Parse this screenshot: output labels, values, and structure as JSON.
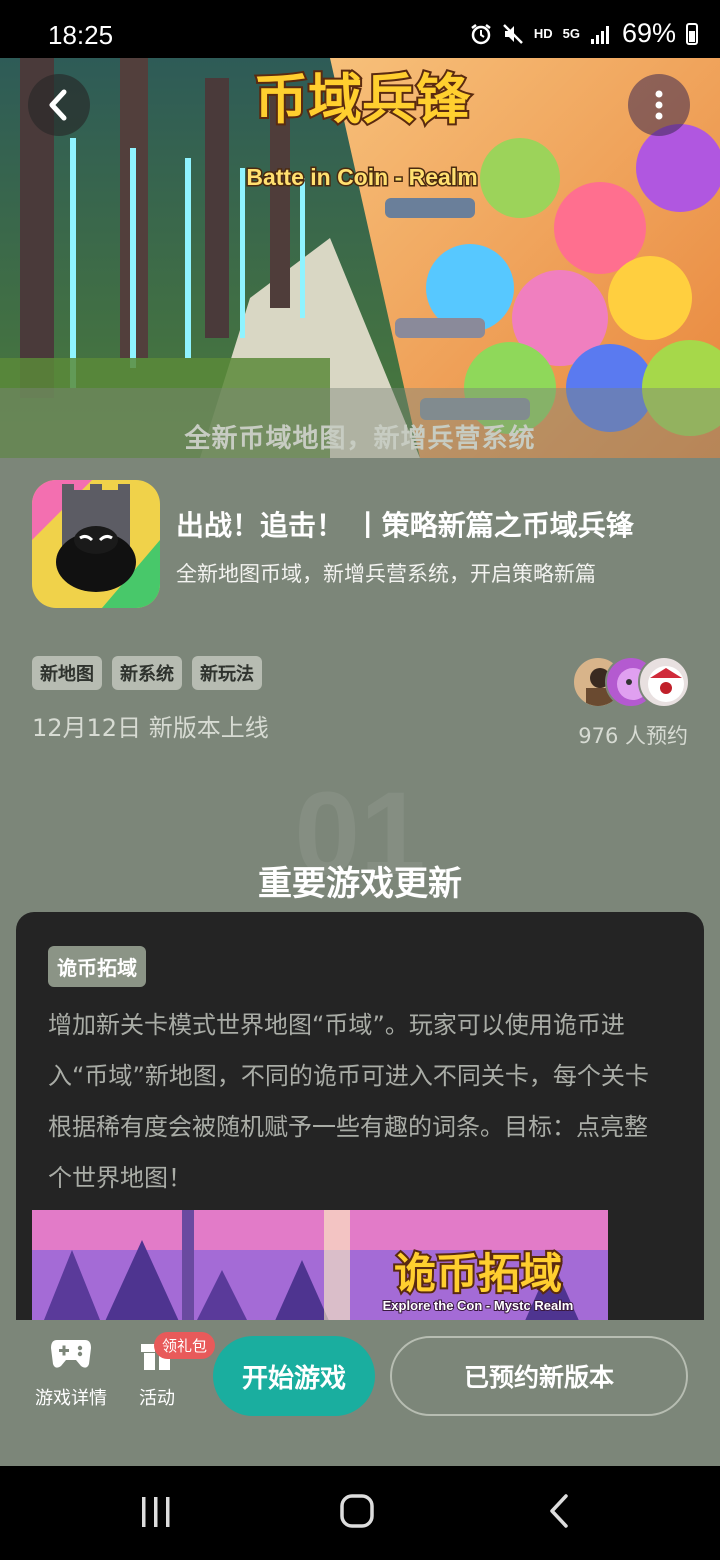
{
  "status_bar": {
    "time": "18:25",
    "icons": [
      "alarm-icon",
      "mute-icon",
      "hd-icon",
      "5g-icon",
      "signal-icon"
    ],
    "hd": "HD",
    "net": "5G",
    "battery": "69%"
  },
  "banner": {
    "logo_title": "币域兵锋",
    "logo_subtitle": "Batte in Coin - Realm",
    "caption": "全新币域地图，新增兵营系统"
  },
  "app": {
    "title": "出战！追击！ 丨策略新篇之币域兵锋",
    "subtitle": "全新地图币域，新增兵营系统，开启策略新篇",
    "tags": [
      "新地图",
      "新系统",
      "新玩法"
    ],
    "release": "12月12日 新版本上线",
    "reserve_count": "976 人预约"
  },
  "section": {
    "number": "01",
    "title": "重要游戏更新"
  },
  "card": {
    "tag": "诡币拓域",
    "text": "增加新关卡模式世界地图“币域”。玩家可以使用诡币进入“币域”新地图，不同的诡币可进入不同关卡，每个关卡根据稀有度会被随机赋予一些有趣的词条。目标：点亮整个世界地图！",
    "image_title": "诡币拓域",
    "image_subtitle": "Explore the Con - Mystc Realm"
  },
  "actions": {
    "details_label": "游戏详情",
    "activity_label": "活动",
    "gift_badge": "领礼包",
    "start_label": "开始游戏",
    "reserved_label": "已预约新版本"
  },
  "colors": {
    "page_bg": "#7c8679",
    "accent": "#1aae9f",
    "card_bg": "#242424",
    "badge": "#e85a5a"
  }
}
